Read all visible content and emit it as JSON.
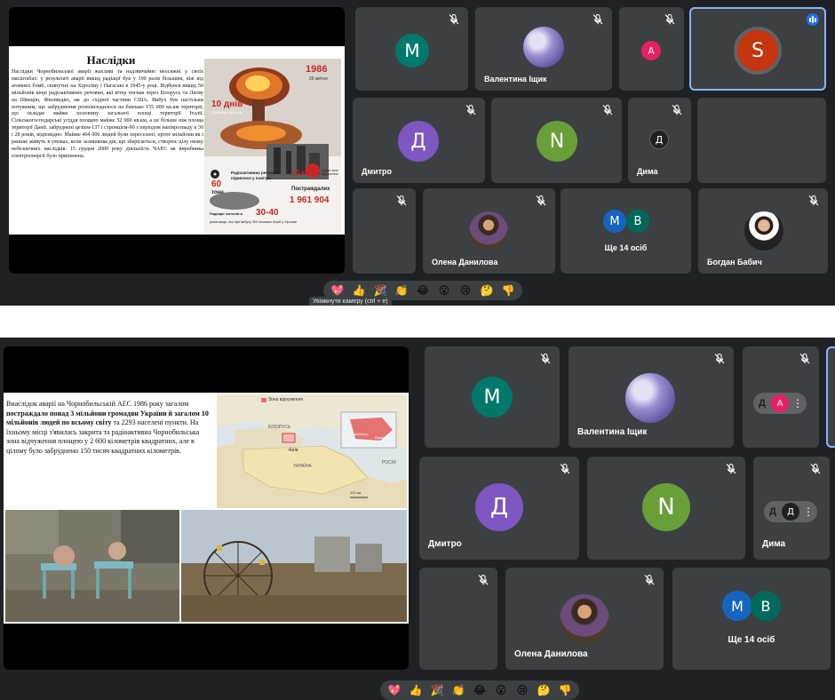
{
  "colors": {
    "panel_bg": "#202124",
    "tile_bg": "#3c4043",
    "speaking_outline": "#8ab4f8",
    "avatar_M": "#00796b",
    "avatar_A": "#e91e63",
    "avatar_S": "#c5350f",
    "avatar_D_purple": "#7e57c2",
    "avatar_N_green": "#689f38",
    "avatar_D_dark": "#3c4043",
    "avatar_M_blue": "#1565c0",
    "avatar_B_teal": "#00695c"
  },
  "top": {
    "slide": {
      "title": "Наслідки",
      "body": "Наслідки Чорнобильської аварії жахливі та надзвичайно неосяжні у своїх масштабах: у результаті аварії викид радіації був у 100 разів більшим, ніж від атомних бомб, скинутих на Хіросіму і Нагасакі в 1945-у році. Відбувся викид 50 мільйонів кюрі радіоактивних речовин, які вітер погнав через Білорусь та Литву на Швецію, Фінляндію, аж до східної частини США. Вибух був настільки потужним, що забруднення розповсюдилося на близько 155 000 кв.км території, що складає майже половину загальної площі території Італії. Сільськогосподарські угіддя площею майже 52 000 кв.км, а це більше ніж площа території Данії. забруднені цезієм-137 і стронцієм-90 з періодом напіврозпаду в 30 і 28 років, відповідно. Майже 404 000 людей були переселені, проте мільйони як і раніше живуть в умовах, коли залишкова дія, що зберігається, створює цілу низку небезпечних наслідків. 15 грудня 2000 року діяльність ЧАЕС як виробника електроенергії було припинена.",
      "infographic": {
        "year": "1986",
        "date": "26 квітня",
        "days": "10 днів",
        "days_caption": "тривала пожежа",
        "tons": "60",
        "tons_unit": "тонн",
        "substances_caption": "Радіоактивних речовин піднялося у повітря",
        "km": "30 км",
        "km_caption": "радіус зони відчуження",
        "victims_label": "Постраждалих",
        "victims": "1 961 904",
        "isotopes": "30-40",
        "isotopes_label": "Радіація ізотопів в",
        "isotopes_caption": "разів вище, ніж при вибуху 300 атомних бомб у Хіросімі"
      }
    },
    "tiles": [
      {
        "name": "",
        "avatar": "M"
      },
      {
        "name": "Валентина Іщик",
        "avatar": "photo"
      },
      {
        "name": "",
        "avatar": "A"
      },
      {
        "name": "",
        "avatar": "S"
      },
      {
        "name": "Дмитро",
        "avatar": "Д"
      },
      {
        "name": "",
        "avatar": "N"
      },
      {
        "name": "Дима",
        "avatar": "Д"
      },
      {
        "name": "",
        "avatar": ""
      },
      {
        "name": "",
        "avatar": ""
      },
      {
        "name": "Олена Данилова",
        "avatar": "photo"
      },
      {
        "name": "Ще 14 осіб",
        "avatar_a": "M",
        "avatar_b": "B"
      },
      {
        "name": "Богдан Бабич",
        "avatar": "photo"
      }
    ],
    "tooltip": "Увімкнути камеру (ctrl + e)"
  },
  "reactions": [
    "💖",
    "👍",
    "🎉",
    "👏",
    "😂",
    "😮",
    "😢",
    "🤔",
    "👎"
  ],
  "bottom": {
    "slide": {
      "paragraph_start": "Внаслідок аварії на Чорнобильській АЕС 1986 року загалом ",
      "paragraph_bold": "постраждало понад 3 мільйони громадян України й загалом 10 мільйонів людей по всьому світу",
      "paragraph_end": " та 2293 населені пункти. На їхньому місці з'явилась закрита та радіоактивна Чорнобильська зона відчуження площею у 2 600 кілометрів квадратних, але в цілому було забруднено 150 тисяч квадратних кілометрів.",
      "map": {
        "legend": "Зона відчуження",
        "label_belarus": "БІЛОРУСЬ",
        "label_ukraine": "УКРАЇНА",
        "label_russia": "РОСІЯ",
        "label_kyiv": "•Київ",
        "inset_label_a": "Чорнобиль",
        "inset_label_b": "Прип'ять",
        "scale": "100 км"
      }
    },
    "tiles": [
      {
        "name": "",
        "avatar": "M"
      },
      {
        "name": "Валентина Іщик",
        "avatar": "photo"
      },
      {
        "name": "",
        "avatar": "A"
      },
      {
        "name": "Дмитро",
        "avatar": "Д"
      },
      {
        "name": "",
        "avatar": "N"
      },
      {
        "name": "Дима",
        "avatar": "Д"
      },
      {
        "name": "",
        "avatar": ""
      },
      {
        "name": "Олена Данилова",
        "avatar": "photo"
      },
      {
        "name": "Ще 14 осіб",
        "avatar_a": "M",
        "avatar_b": "B"
      }
    ],
    "hover_initials_a": "Д",
    "hover_initials_b": "Д"
  }
}
